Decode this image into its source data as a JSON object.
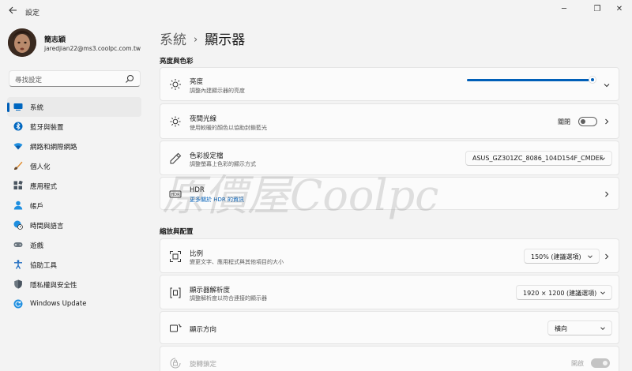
{
  "titlebar": {
    "app_title": "設定",
    "back_icon": "back-arrow-icon",
    "minimize": "─",
    "maximize": "❐",
    "close": "✕"
  },
  "profile": {
    "name": "簡志穎",
    "email": "jaredjian22@ms3.coolpc.com.tw"
  },
  "search": {
    "placeholder": "尋找設定"
  },
  "nav": {
    "items": [
      {
        "label": "系統",
        "icon": "system-icon",
        "active": true
      },
      {
        "label": "藍牙與裝置",
        "icon": "bluetooth-icon"
      },
      {
        "label": "網路和網際網路",
        "icon": "network-icon"
      },
      {
        "label": "個人化",
        "icon": "brush-icon"
      },
      {
        "label": "應用程式",
        "icon": "apps-icon"
      },
      {
        "label": "帳戶",
        "icon": "account-icon"
      },
      {
        "label": "時間與語言",
        "icon": "clock-globe-icon"
      },
      {
        "label": "遊戲",
        "icon": "gamepad-icon"
      },
      {
        "label": "協助工具",
        "icon": "accessibility-icon"
      },
      {
        "label": "隱私權與安全性",
        "icon": "shield-icon"
      },
      {
        "label": "Windows Update",
        "icon": "update-icon"
      }
    ]
  },
  "breadcrumb": {
    "parent": "系統",
    "separator": "›",
    "current": "顯示器"
  },
  "sections": {
    "brightness_color": "亮度與色彩",
    "scale_layout": "縮放與配置"
  },
  "brightness": {
    "title": "亮度",
    "subtitle": "調整內建顯示器的亮度",
    "level": 1.0
  },
  "night_light": {
    "title": "夜間光線",
    "subtitle": "使用較暖的顏色以協助封鎖藍光",
    "state_label": "關閉",
    "on": false
  },
  "color_profile": {
    "title": "色彩設定檔",
    "subtitle": "調整螢幕上色彩的顯示方式",
    "value": "ASUS_GZ301ZC_8086_104D154F_CMDEF"
  },
  "hdr": {
    "title": "HDR",
    "subtitle": "更多關於 HDR 的資訊"
  },
  "scale": {
    "title": "比例",
    "subtitle": "變更文字、應用程式與其他項目的大小",
    "value": "150% (建議選項)"
  },
  "resolution": {
    "title": "顯示器解析度",
    "subtitle": "調整解析度以符合連接的顯示器",
    "value": "1920 × 1200 (建議選項)"
  },
  "orientation": {
    "title": "顯示方向",
    "value": "橫向"
  },
  "rotation_lock": {
    "title": "旋轉鎖定",
    "state_label": "開啟",
    "on": true,
    "enabled": false
  },
  "watermark": {
    "text": "原價屋Coolpc"
  }
}
